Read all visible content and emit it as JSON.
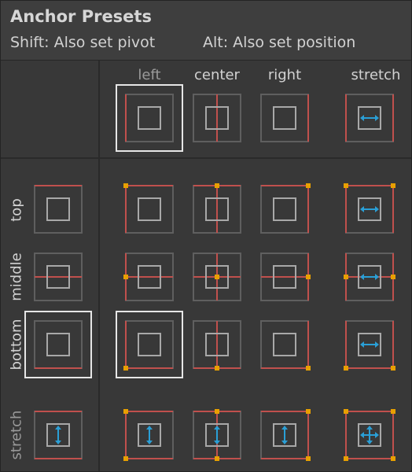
{
  "title": "Anchor Presets",
  "hint_shift": "Shift: Also set pivot",
  "hint_alt": "Alt: Also set position",
  "columns": [
    {
      "key": "left",
      "label": "left",
      "selected": true
    },
    {
      "key": "center",
      "label": "center",
      "selected": false
    },
    {
      "key": "right",
      "label": "right",
      "selected": false
    },
    {
      "key": "stretch",
      "label": "stretch",
      "selected": false
    }
  ],
  "rows": [
    {
      "key": "top",
      "label": "top",
      "selected": false
    },
    {
      "key": "middle",
      "label": "middle",
      "selected": false
    },
    {
      "key": "bottom",
      "label": "bottom",
      "selected": true
    },
    {
      "key": "stretch",
      "label": "stretch",
      "selected": false
    }
  ],
  "current_preset": {
    "column": "left",
    "row": "bottom"
  },
  "colors": {
    "header_bg": "#3e3e3e",
    "panel_bg": "#383838",
    "frame": "#5f5f5f",
    "inner": "#a8a8a8",
    "anchor_line": "#c0504d",
    "pivot_dot": "#e8a000",
    "stretch_arrow": "#2a9fd6",
    "selection": "#e6e6e6",
    "label_dim": "#9a9a9a",
    "label": "#d2d2d2"
  },
  "icons": {
    "anchor_cell": "anchor-preset-icon",
    "stretch_h": "horizontal-stretch-arrow-icon",
    "stretch_v": "vertical-stretch-arrow-icon"
  }
}
